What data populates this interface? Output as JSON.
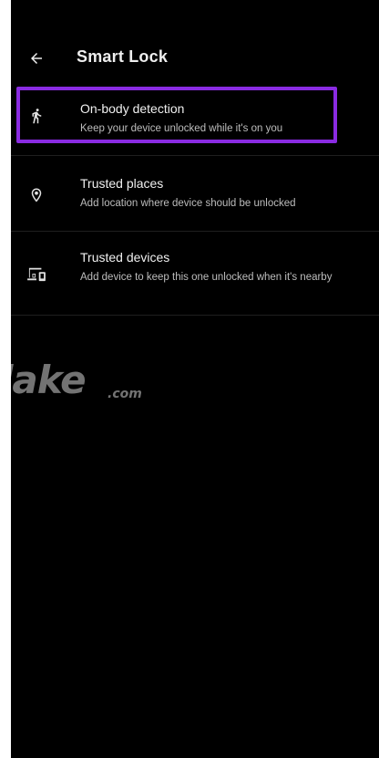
{
  "app_bar": {
    "back_icon": "arrow-left-icon",
    "title": "Smart Lock"
  },
  "items": [
    {
      "icon": "walking-person-icon",
      "title": "On-body detection",
      "subtitle": "Keep your device unlocked while it's on you",
      "highlighted": true
    },
    {
      "icon": "location-pin-icon",
      "title": "Trusted places",
      "subtitle": "Add location where device should be unlocked"
    },
    {
      "icon": "devices-icon",
      "title": "Trusted devices",
      "subtitle": "Add device to keep this one unlocked when it's nearby"
    }
  ],
  "highlight_color": "#8a2be2",
  "watermark": {
    "text": "lake",
    "suffix": ".com"
  }
}
